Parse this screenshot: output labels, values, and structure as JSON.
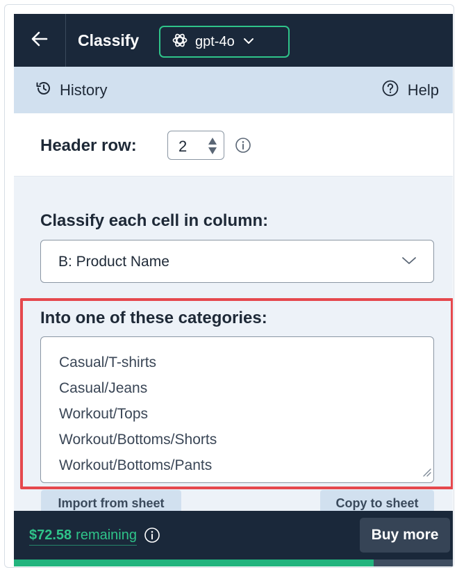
{
  "topbar": {
    "back_icon": "arrow-left-icon",
    "title": "Classify",
    "model": {
      "icon": "openai-logo-icon",
      "name": "gpt-4o",
      "chevron": "chevron-down-icon"
    }
  },
  "subbar": {
    "history_label": "History",
    "history_icon": "history-icon",
    "help_label": "Help",
    "help_icon": "question-circle-icon"
  },
  "header_row": {
    "label": "Header row:",
    "value": "2",
    "info_icon": "info-icon"
  },
  "column": {
    "label": "Classify each cell in column:",
    "selected": "B: Product Name"
  },
  "categories": {
    "label": "Into one of these categories:",
    "items": [
      "Casual/T-shirts",
      "Casual/Jeans",
      "Workout/Tops",
      "Workout/Bottoms/Shorts",
      "Workout/Bottoms/Pants"
    ],
    "import_label": "Import from sheet",
    "copy_label": "Copy to sheet"
  },
  "footer": {
    "balance": "$72.58",
    "balance_label": "remaining",
    "buy_label": "Buy more",
    "usage_fraction": 0.82
  },
  "colors": {
    "dark": "#1a283a",
    "accent_green": "#2fc48a",
    "light_blue": "#d1e0ef",
    "highlight_red": "#e5484d"
  }
}
